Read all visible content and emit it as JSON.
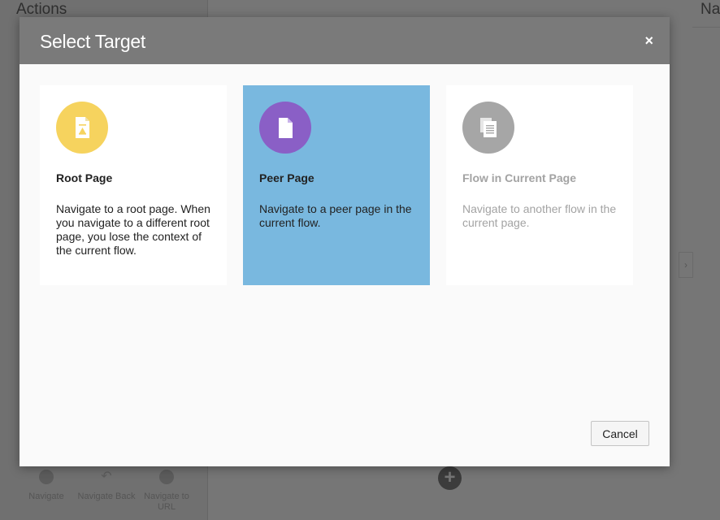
{
  "background": {
    "left_panel_title": "Actions",
    "right_panel_title": "Na",
    "tools": [
      {
        "label": "Navigate",
        "icon": "compass-icon"
      },
      {
        "label": "Navigate Back",
        "icon": "back-arrow-icon"
      },
      {
        "label": "Navigate to URL",
        "icon": "link-icon"
      }
    ],
    "add_icon": "+",
    "chevron_icon": "›"
  },
  "dialog": {
    "title": "Select Target",
    "close_icon": "×",
    "cancel_label": "Cancel",
    "options": [
      {
        "title": "Root Page",
        "description": "Navigate to a root page. When you navigate to a different root page, you lose the context of the current flow.",
        "icon": "root-page-icon",
        "icon_color": "#f6d35e",
        "selected": false,
        "disabled": false
      },
      {
        "title": "Peer Page",
        "description": "Navigate to a peer page in the current flow.",
        "icon": "peer-page-icon",
        "icon_color": "#8a5fc6",
        "selected": true,
        "disabled": false
      },
      {
        "title": "Flow in Current Page",
        "description": "Navigate to another flow in the current page.",
        "icon": "flow-pages-icon",
        "icon_color": "#a6a6a6",
        "selected": false,
        "disabled": true
      }
    ]
  },
  "colors": {
    "selected_card": "#79b8df",
    "header": "#7a7a7a"
  }
}
